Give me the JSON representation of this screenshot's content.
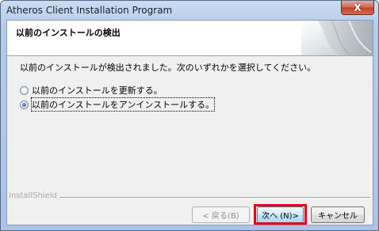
{
  "window": {
    "title": "Atheros Client Installation Program",
    "close_label": "X"
  },
  "header": {
    "title": "以前のインストールの検出"
  },
  "body": {
    "description": "以前のインストールが検出されました。次のいずれかを選択してください。",
    "options": [
      {
        "label": "以前のインストールを更新する。",
        "selected": false
      },
      {
        "label": "以前のインストールをアンインストールする。",
        "selected": true
      }
    ]
  },
  "footer": {
    "brand": "InstallShield",
    "back_label": "< 戻る(B)",
    "next_label": "次へ (N)>",
    "cancel_label": "キャンセル"
  },
  "colors": {
    "highlight": "#e60012",
    "close_button": "#c0442b"
  }
}
